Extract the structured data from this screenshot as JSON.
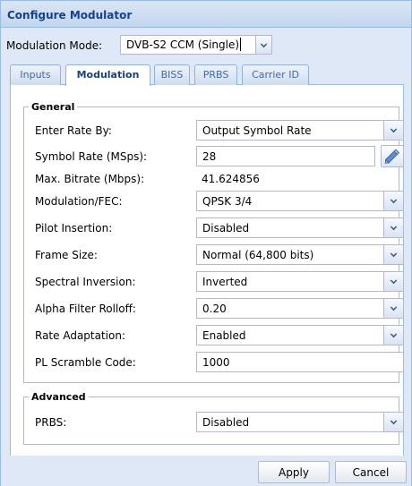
{
  "dialog": {
    "title": "Configure Modulator"
  },
  "mode": {
    "label": "Modulation Mode:",
    "value": "DVB-S2 CCM (Single)"
  },
  "tabs": [
    {
      "label": "Inputs",
      "active": false
    },
    {
      "label": "Modulation",
      "active": true
    },
    {
      "label": "BISS",
      "active": false
    },
    {
      "label": "PRBS",
      "active": false
    },
    {
      "label": "Carrier ID",
      "active": false
    }
  ],
  "general": {
    "legend": "General",
    "rows": [
      {
        "label": "Enter Rate By:",
        "value": "Output Symbol Rate",
        "kind": "select"
      },
      {
        "label": "Symbol Rate (MSps):",
        "value": "28",
        "kind": "input",
        "action_icon": "pencil-icon"
      },
      {
        "label": "Max. Bitrate (Mbps):",
        "value": "41.624856",
        "kind": "static"
      },
      {
        "label": "Modulation/FEC:",
        "value": "QPSK 3/4",
        "kind": "select"
      },
      {
        "label": "Pilot Insertion:",
        "value": "Disabled",
        "kind": "select"
      },
      {
        "label": "Frame Size:",
        "value": "Normal (64,800 bits)",
        "kind": "select"
      },
      {
        "label": "Spectral Inversion:",
        "value": "Inverted",
        "kind": "select"
      },
      {
        "label": "Alpha Filter Rolloff:",
        "value": "0.20",
        "kind": "select"
      },
      {
        "label": "Rate Adaptation:",
        "value": "Enabled",
        "kind": "select"
      },
      {
        "label": "PL Scramble Code:",
        "value": "1000",
        "kind": "input"
      }
    ]
  },
  "advanced": {
    "legend": "Advanced",
    "rows": [
      {
        "label": "PRBS:",
        "value": "Disabled",
        "kind": "select"
      }
    ]
  },
  "footer": {
    "apply_label": "Apply",
    "cancel_label": "Cancel"
  },
  "colors": {
    "accent": "#15428b",
    "frame": "#dfe8f6",
    "border": "#99bbe8"
  }
}
